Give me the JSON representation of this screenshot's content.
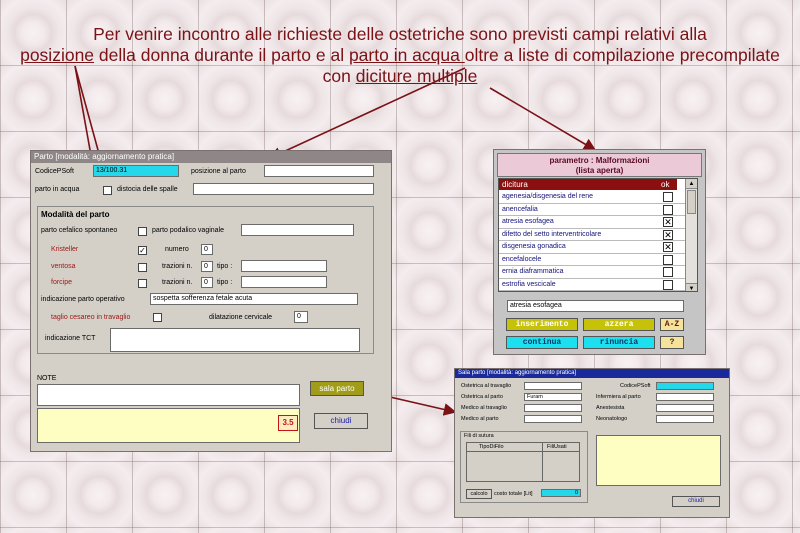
{
  "caption": {
    "p1": "Per venire incontro alle richieste delle ostetriche sono previsti campi relativi alla",
    "u1": "posizione",
    "p2": " della donna durante il parto e al ",
    "u2": "parto in acqua ",
    "p3": "oltre a liste di compilazione precompilate con ",
    "u3": "diciture multiple"
  },
  "parto": {
    "title": "Parto [modalità: aggiornamento pratica]",
    "codice_label": "CodicePSoft",
    "codice_value": "13/100.31",
    "posizione_label": "posizione al parto",
    "acqua_label": "parto in acqua",
    "distocia_label": "distocia delle spalle",
    "modalita_title": "Modalità del parto",
    "cefalico_label": "parto cefalico spontaneo",
    "podalico_label": "parto podalico vaginale",
    "kristeller_label": "Kristeller",
    "kristeller_check": "✓",
    "numero_label": "numero",
    "numero_value": "0",
    "ventosa_label": "ventosa",
    "forcipe_label": "forcipe",
    "trazioni_label": "trazioni n.",
    "ventosa_trazioni": "0",
    "forcipe_trazioni": "0",
    "tipo_label": "tipo :",
    "operativo_label": "indicazione parto operativo",
    "operativo_value": "sospetta sofferenza fetale acuta",
    "cesareo_label": "taglio cesareo in travaglio",
    "dilatazione_label": "dilatazione cervicale",
    "dilatazione_value": "0",
    "tct_label": "indicazione TCT",
    "note_label": "NOTE",
    "sala_button": "sala parto",
    "chiudi_button": "chiudi",
    "badge": "3.5"
  },
  "lista": {
    "title1": "parametro : Malformazioni",
    "title2": "(lista aperta)",
    "col1": "dicitura",
    "col2": "ok",
    "items": [
      {
        "t": "agenesia/disgenesia del rene",
        "c": ""
      },
      {
        "t": "anencefalia",
        "c": ""
      },
      {
        "t": "atresia esofagea",
        "c": "✕"
      },
      {
        "t": "difetto del setto interventricolare",
        "c": "✕"
      },
      {
        "t": "disgenesia gonadica",
        "c": "✕"
      },
      {
        "t": "encefalocele",
        "c": ""
      },
      {
        "t": "ernia diaframmatica",
        "c": ""
      },
      {
        "t": "estrofia vescicale",
        "c": ""
      }
    ],
    "selected": "atresia esofagea",
    "inserimento": "inserimento",
    "azzera": "azzera",
    "az": "A-Z",
    "continua": "continua",
    "rinuncia": "rinuncia",
    "help": "?"
  },
  "sala": {
    "title": "Sala parto [modalità: aggiornamento pratica]",
    "travaglio_label": "Ostetrica al travaglio",
    "ostetrica_parto_label": "Ostetrica al parto",
    "ostetrica_parto_value": "Furam",
    "medico_travaglio_label": "Medico al travaglio",
    "medico_parto_label": "Medico al parto",
    "codice_label": "CodicePSoft",
    "infermiera_label": "Infermiera al parto",
    "anestesista_label": "Anestesista",
    "neonatologo_label": "Neonatologo",
    "fili_label": "Fili di sutura",
    "col_tipo": "TipoDiFilo",
    "col_fili": "FiliUsati",
    "calcolo": "calcolo",
    "costo_label": "costo totale [Lit]",
    "costo_value": "0",
    "chiudi": "chiudi"
  }
}
